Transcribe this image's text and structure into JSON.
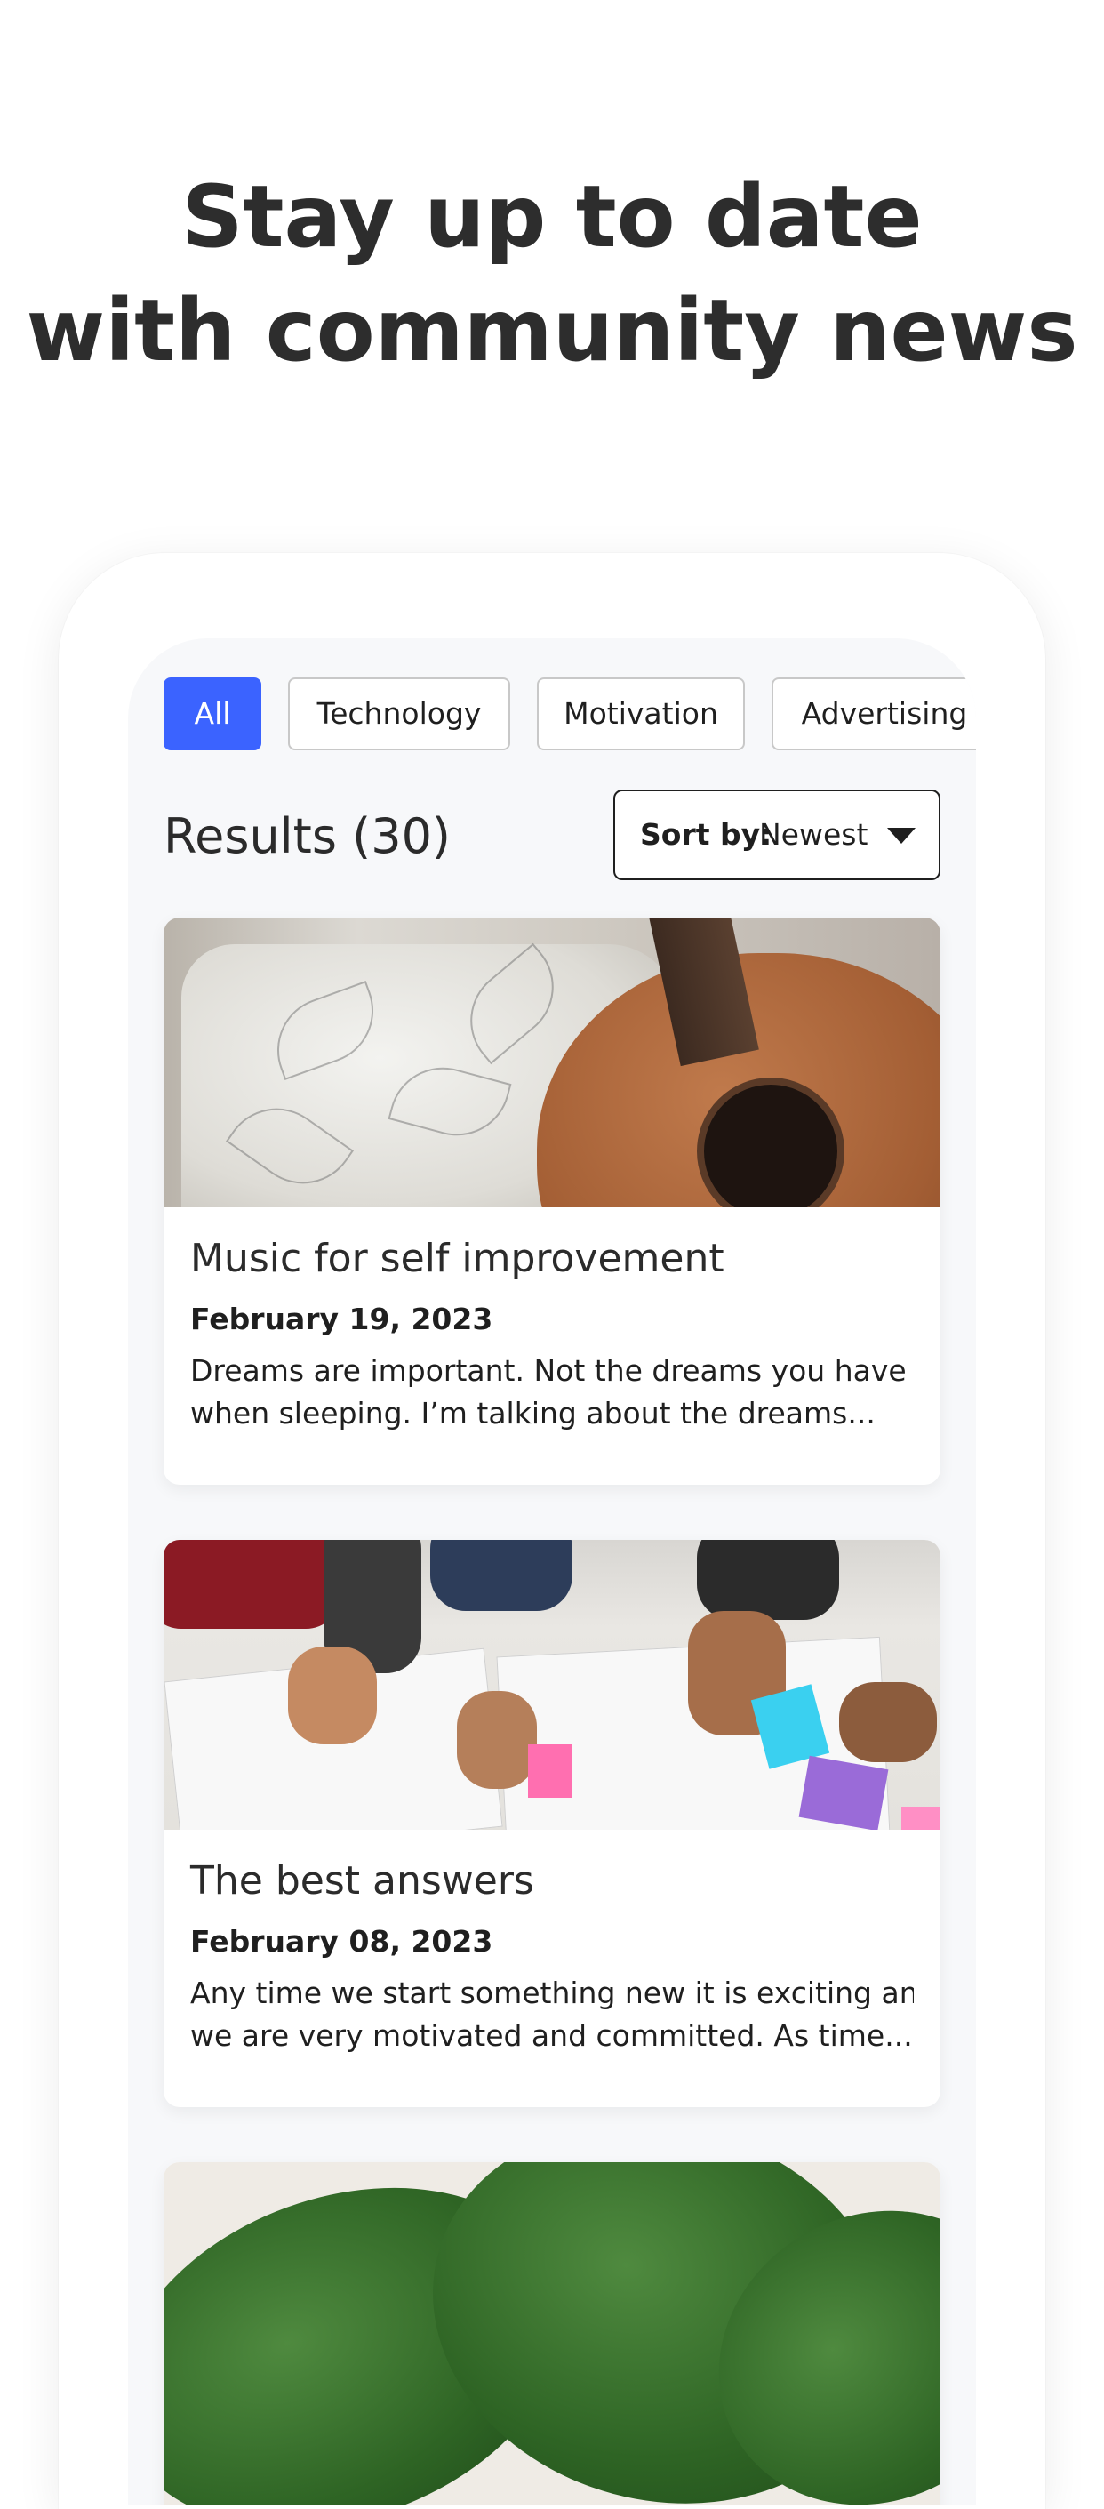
{
  "headline": {
    "line1": "Stay up to date",
    "line2": "with community news"
  },
  "filters": {
    "chips": [
      {
        "label": "All",
        "active": true
      },
      {
        "label": "Technology",
        "active": false
      },
      {
        "label": "Motivation",
        "active": false
      },
      {
        "label": "Advertising",
        "active": false
      }
    ]
  },
  "results": {
    "title": "Results (30)",
    "sort_label": "Sort by:",
    "sort_value": "Newest"
  },
  "articles": [
    {
      "image": "guitar-photo",
      "title": "Music for self improvement",
      "date": "February 19, 2023",
      "excerpt_line1": "Dreams are important. Not the dreams you have",
      "excerpt_line2": "when sleeping. I’m talking about the dreams..."
    },
    {
      "image": "planning-photo",
      "title": "The best answers",
      "date": "February 08, 2023",
      "excerpt_line1": "Any time we start something new it is exciting and",
      "excerpt_line2": "we are very motivated and committed. As time..."
    },
    {
      "image": "monstera-leaf-photo"
    }
  ],
  "colors": {
    "accent": "#3b63ff",
    "screen_bg": "#f7f8fa",
    "text": "#2b2b2b"
  }
}
